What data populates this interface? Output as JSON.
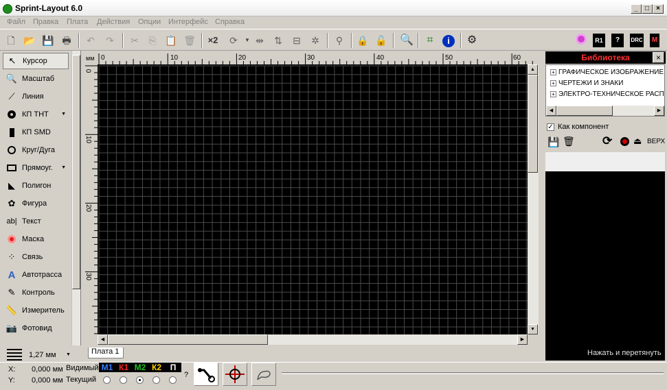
{
  "window": {
    "title": "Sprint-Layout 6.0"
  },
  "menu": [
    "Файл",
    "Правка",
    "Плата",
    "Действия",
    "Опции",
    "Интерфейс",
    "Справка"
  ],
  "toolbar": {
    "zoom_x2": "×2"
  },
  "tools": [
    {
      "label": "Курсор",
      "icon": "cursor-icon",
      "active": true
    },
    {
      "label": "Масштаб",
      "icon": "zoom-icon"
    },
    {
      "label": "Линия",
      "icon": "line-icon"
    },
    {
      "label": "КП ТНТ",
      "icon": "tht-pad-icon",
      "dropdown": true
    },
    {
      "label": "КП SMD",
      "icon": "smd-pad-icon"
    },
    {
      "label": "Круг/Дуга",
      "icon": "circle-icon"
    },
    {
      "label": "Прямоуг.",
      "icon": "rectangle-icon",
      "dropdown": true
    },
    {
      "label": "Полигон",
      "icon": "polygon-icon"
    },
    {
      "label": "Фигура",
      "icon": "shape-icon"
    },
    {
      "label": "Текст",
      "icon": "text-icon"
    },
    {
      "label": "Маска",
      "icon": "mask-icon"
    },
    {
      "label": "Связь",
      "icon": "connection-icon"
    },
    {
      "label": "Автотрасса",
      "icon": "autoroute-icon"
    },
    {
      "label": "Контроль",
      "icon": "control-icon"
    },
    {
      "label": "Измеритель",
      "icon": "measure-icon"
    },
    {
      "label": "Фотовид",
      "icon": "photoview-icon"
    }
  ],
  "grid": {
    "value": "1,27 мм"
  },
  "ruler": {
    "unit": "мм",
    "top_labels": [
      "0",
      "10",
      "20",
      "30",
      "40",
      "50",
      "60"
    ],
    "left_labels": [
      "0",
      "10",
      "20",
      "30"
    ]
  },
  "tabs": [
    "Плата 1"
  ],
  "library": {
    "title": "Библиотека",
    "tree": [
      "ГРАФИЧЕСКОЕ ИЗОБРАЖЕНИЕ",
      "ЧЕРТЕЖИ И ЗНАКИ",
      "ЭЛЕКТРО-ТЕХНИЧЕСКОЕ РАСП"
    ],
    "as_component_label": "Как компонент",
    "as_component_checked": true,
    "side_label": "ВЕРХ",
    "drag_hint": "Нажать и перетянуть"
  },
  "status": {
    "x_label": "X:",
    "x_value": "0,000 мм",
    "y_label": "Y:",
    "y_value": "0,000 мм",
    "visible_label": "Видимый",
    "current_label": "Текущий",
    "help_mark": "?",
    "layers": [
      {
        "name": "М1",
        "color": "#3a7dff"
      },
      {
        "name": "К1",
        "color": "#ff2020"
      },
      {
        "name": "М2",
        "color": "#20c020"
      },
      {
        "name": "К2",
        "color": "#ffd000"
      },
      {
        "name": "П",
        "color": "#ffffff"
      }
    ],
    "current_layer_index": 2
  },
  "colors": {
    "canvas_bg": "#000000",
    "grid_line": "#4a4a4a",
    "library_title": "#ff3030"
  }
}
